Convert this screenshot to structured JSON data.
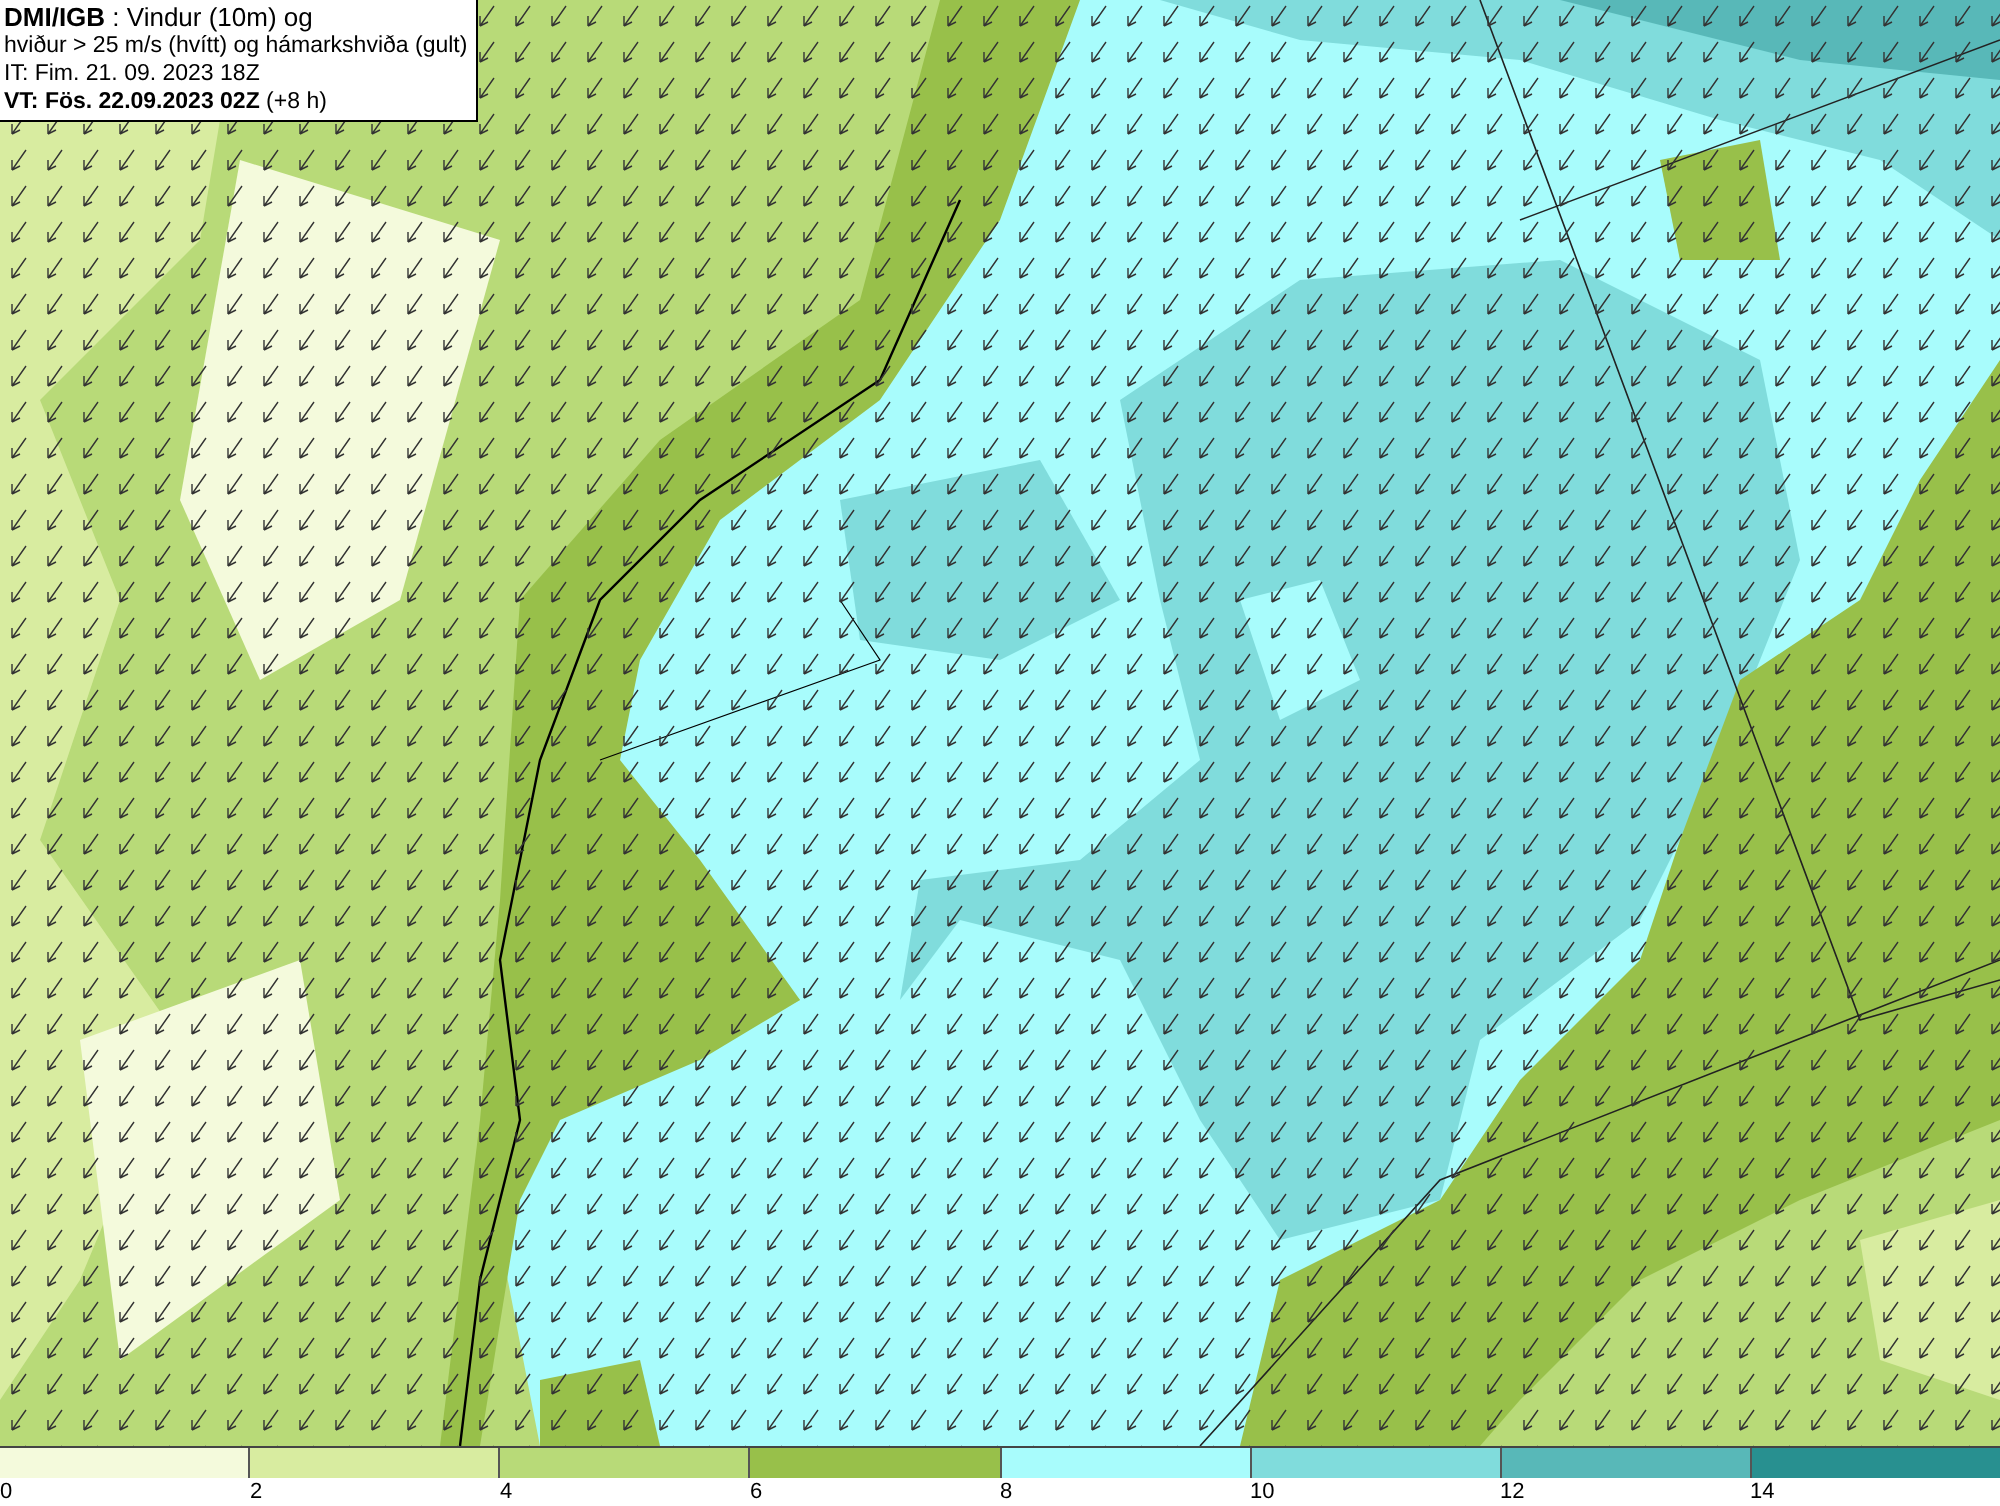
{
  "header": {
    "lines": [
      "**DMI/IGB** : Vindur (10m) og",
      "hviður > 25 m/s (hvítt) og hámarkshviða (gult)",
      "IT: Fim. 21. 09. 2023 18Z",
      "**VT: Fös. 22.09.2023 02Z** (+8 h)"
    ]
  },
  "legend": {
    "bins": [
      {
        "label": "0",
        "color": "#f4fadc"
      },
      {
        "label": "2",
        "color": "#d8eca0"
      },
      {
        "label": "4",
        "color": "#b8da78"
      },
      {
        "label": "6",
        "color": "#98c04a"
      },
      {
        "label": "8",
        "color": "#a8fcfc"
      },
      {
        "label": "10",
        "color": "#80dcdc"
      },
      {
        "label": "12",
        "color": "#58b8b8"
      },
      {
        "label": "14",
        "color": "#289090"
      }
    ]
  }
}
